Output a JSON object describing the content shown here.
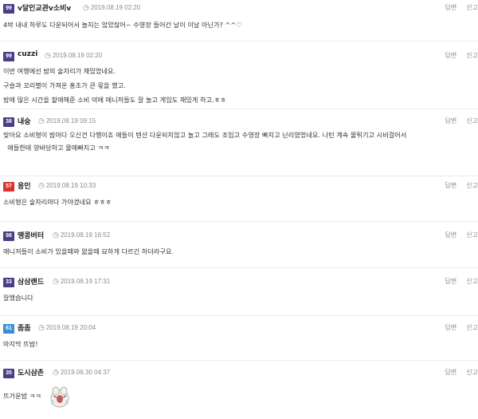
{
  "actions": {
    "reply": "답변",
    "report": "신고"
  },
  "comments": [
    {
      "level": "99",
      "level_color": "#4b3e86",
      "nick": "v달인교관v소비v",
      "time": "2019.08.19 02:20",
      "lines": [
        "4박 내내 하루도 다운되어서 놀지는 않았잖어~ 수영장 들어간 날이 이날 아닌가? ^^♡"
      ]
    },
    {
      "level": "99",
      "level_color": "#4b3e86",
      "nick": "cuzzi",
      "time": "2019.08.19 02:20",
      "lines": [
        "이번 여행에선 밤의 술자리가 재밌었네요.",
        "구슬과 꼬리별이 가져온 홍초가 큰 몫을 했고.",
        "밤에 많은 시간을 할애해준 소비 덕에 매니저들도 잘 놀고 게임도 재밌게 하고.ㅎㅎ"
      ]
    },
    {
      "level": "38",
      "level_color": "#4b3e86",
      "nick": "내숭",
      "time": "2019.08.19 09:15",
      "lines": [
        "맞아요   소비형이 밤마다 오신건 다행이죠   애들이 텐션 다운되지않고 놀고 그래도 조입고 수영장 빠지고 난리였었네요.   나턴 계속 물튀기고 시비걸어서",
        "  애들한테 양바당하고 물에빠지고 ㅋㅋ"
      ]
    },
    {
      "level": "57",
      "level_color": "#d9312f",
      "nick": "용인",
      "time": "2019.08.19 10:33",
      "lines": [
        "소비형은 술자리마다 가야겠네요 ㅎㅎㅎ"
      ]
    },
    {
      "level": "98",
      "level_color": "#4b3e86",
      "nick": "땡콩버터",
      "time": "2019.08.19 16:52",
      "lines": [
        "매니저들이 소비가 있을때와 없을때 묘하게 다르긴 하더라구요."
      ]
    },
    {
      "level": "33",
      "level_color": "#4b3e86",
      "nick": "삼삼랜드",
      "time": "2019.08.19 17:31",
      "lines": [
        "잘했습니다"
      ]
    },
    {
      "level": "61",
      "level_color": "#3d8fd4",
      "nick": "좀좀",
      "time": "2019.08.19 20:04",
      "lines": [
        "마지막 뜨밤!"
      ]
    },
    {
      "level": "35",
      "level_color": "#4b3e86",
      "nick": "도시샴촌",
      "time": "2019.08.30 04:37",
      "lines": [
        "뜨거운밤 ㅋㅋ"
      ],
      "emoticon": "crying-character-emoticon"
    }
  ]
}
